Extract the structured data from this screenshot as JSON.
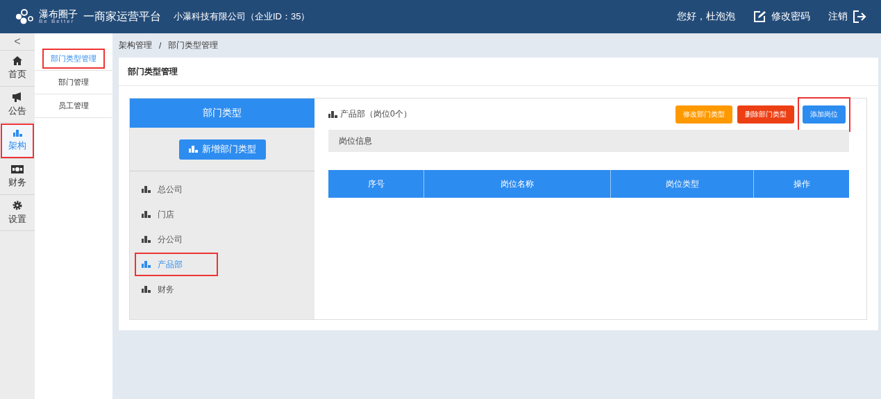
{
  "header": {
    "logo_name": "瀑布圈子",
    "logo_tagline": "Be Better",
    "platform": "一商家运营平台",
    "company": "小瀑科技有限公司（企业ID：35）",
    "greeting": "您好，杜泡泡",
    "change_password": "修改密码",
    "logout": "注销"
  },
  "rail": {
    "collapse": "<",
    "items": [
      {
        "label": "首页",
        "kind": "home",
        "selected": false,
        "marked": false
      },
      {
        "label": "公告",
        "kind": "megaphone",
        "selected": false,
        "marked": false
      },
      {
        "label": "架构",
        "kind": "bars",
        "selected": true,
        "marked": true
      },
      {
        "label": "财务",
        "kind": "money",
        "selected": false,
        "marked": false
      },
      {
        "label": "设置",
        "kind": "gear",
        "selected": false,
        "marked": false
      }
    ]
  },
  "subnav": [
    {
      "label": "部门类型管理",
      "selected": true,
      "marked": true
    },
    {
      "label": "部门管理",
      "selected": false,
      "marked": false
    },
    {
      "label": "员工管理",
      "selected": false,
      "marked": false
    }
  ],
  "breadcrumb": {
    "separator": "/",
    "items": [
      "架构管理",
      "部门类型管理"
    ]
  },
  "card_title": "部门类型管理",
  "types_panel": {
    "title": "部门类型",
    "add_button": "新增部门类型",
    "items": [
      {
        "label": "总公司",
        "selected": false,
        "marked": false
      },
      {
        "label": "门店",
        "selected": false,
        "marked": false
      },
      {
        "label": "分公司",
        "selected": false,
        "marked": false
      },
      {
        "label": "产品部",
        "selected": true,
        "marked": true
      },
      {
        "label": "财务",
        "selected": false,
        "marked": false
      }
    ]
  },
  "detail": {
    "title": "产品部（岗位0个）",
    "buttons": [
      {
        "label": "修改部门类型",
        "kind": "warning",
        "marked": false
      },
      {
        "label": "删除部门类型",
        "kind": "danger",
        "marked": false
      },
      {
        "label": "添加岗位",
        "kind": "primary",
        "marked": true
      }
    ],
    "section": "岗位信息",
    "table": {
      "columns": [
        "序号",
        "岗位名称",
        "岗位类型",
        "操作"
      ]
    }
  }
}
